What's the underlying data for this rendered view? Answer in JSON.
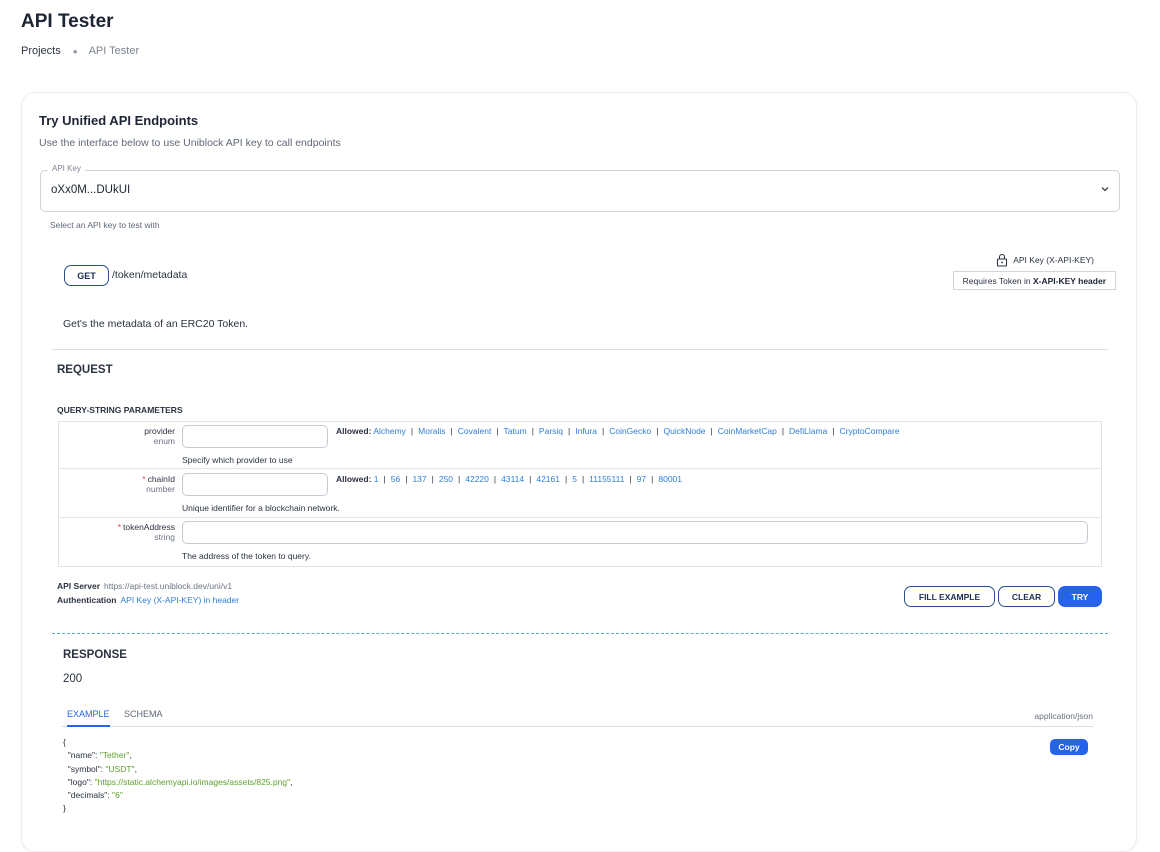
{
  "header": {
    "title": "API Tester",
    "breadcrumbs": [
      "Projects",
      "API Tester"
    ]
  },
  "card": {
    "title": "Try Unified API Endpoints",
    "subtitle": "Use the interface below to use Uniblock API key to call endpoints",
    "api_key": {
      "label": "API Key",
      "value": "oXx0M...DUkUI",
      "help": "Select an API key to test with"
    }
  },
  "endpoint": {
    "method": "GET",
    "path": "/token/metadata",
    "auth_label": "API Key (X-API-KEY)",
    "auth_note_prefix": "Requires Token in",
    "auth_note_bold": "X-API-KEY header",
    "description": "Get's the metadata of an ERC20 Token."
  },
  "request": {
    "title": "REQUEST",
    "query_title": "QUERY-STRING PARAMETERS",
    "allowed_label": "Allowed:",
    "params": [
      {
        "name": "provider",
        "type": "enum",
        "required": false,
        "help": "Specify which provider to use",
        "allowed": [
          "Alchemy",
          "Moralis",
          "Covalent",
          "Tatum",
          "Parsiq",
          "Infura",
          "CoinGecko",
          "QuickNode",
          "CoinMarketCap",
          "DefiLlama",
          "CryptoCompare"
        ]
      },
      {
        "name": "chainId",
        "type": "number",
        "required": true,
        "help": "Unique identifier for a blockchain network.",
        "allowed": [
          "1",
          "56",
          "137",
          "250",
          "42220",
          "43114",
          "42161",
          "5",
          "11155111",
          "97",
          "80001"
        ]
      },
      {
        "name": "tokenAddress",
        "type": "string",
        "required": true,
        "help": "The address of the token to query.",
        "allowed": []
      }
    ],
    "server_label": "API Server",
    "server_url": "https://api-test.uniblock.dev/uni/v1",
    "auth_label": "Authentication",
    "auth_value": "API Key (X-API-KEY) in header",
    "buttons": {
      "fill_example": "FILL EXAMPLE",
      "clear": "CLEAR",
      "try": "TRY"
    }
  },
  "response": {
    "title": "RESPONSE",
    "status": "200",
    "tabs": [
      "EXAMPLE",
      "SCHEMA"
    ],
    "active_tab": "EXAMPLE",
    "content_type": "application/json",
    "copy_label": "Copy",
    "example": [
      {
        "key": "name",
        "value": "Tether"
      },
      {
        "key": "symbol",
        "value": "USDT"
      },
      {
        "key": "logo",
        "value": "https://static.alchemyapi.io/images/assets/825.png"
      },
      {
        "key": "decimals",
        "value": "6"
      }
    ]
  },
  "colors": {
    "accent": "#2563eb",
    "link": "#2f7fd6",
    "required": "#e04848",
    "string": "#5e9f2c"
  },
  "icons": [
    "chevron-down-icon",
    "lock-icon"
  ]
}
